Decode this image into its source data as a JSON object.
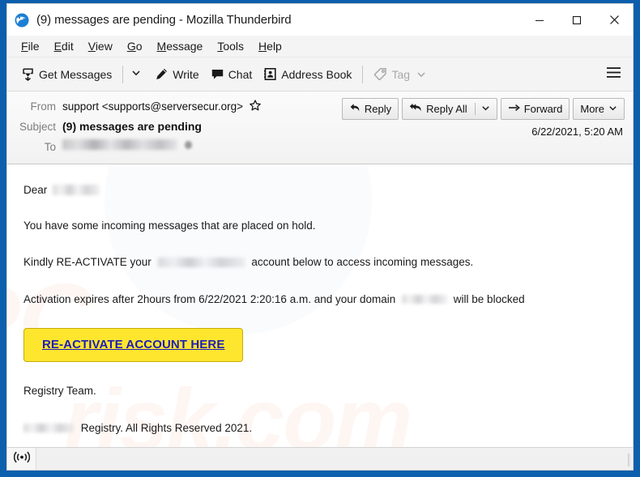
{
  "window": {
    "title": "(9) messages are pending - Mozilla Thunderbird",
    "logo_icon": "thunderbird-logo-icon",
    "controls": {
      "minimize": "minimize-icon",
      "maximize": "maximize-icon",
      "close": "close-icon"
    },
    "frame_color": "#0c5fad"
  },
  "menubar": {
    "items": [
      {
        "label": "File",
        "accel": "F"
      },
      {
        "label": "Edit",
        "accel": "E"
      },
      {
        "label": "View",
        "accel": "V"
      },
      {
        "label": "Go",
        "accel": "G"
      },
      {
        "label": "Message",
        "accel": "M"
      },
      {
        "label": "Tools",
        "accel": "T"
      },
      {
        "label": "Help",
        "accel": "H"
      }
    ]
  },
  "toolbar": {
    "get_messages_label": "Get Messages",
    "get_messages_icon": "download-tray-icon",
    "get_messages_caret_icon": "chevron-down-icon",
    "write_label": "Write",
    "write_icon": "pencil-icon",
    "chat_label": "Chat",
    "chat_icon": "speech-bubble-icon",
    "address_book_label": "Address Book",
    "address_book_icon": "address-book-icon",
    "tag_label": "Tag",
    "tag_icon": "tag-icon",
    "tag_caret_icon": "chevron-down-icon",
    "tag_disabled": true,
    "app_menu_icon": "hamburger-menu-icon"
  },
  "message_header": {
    "from_label": "From",
    "from_value": "support <supports@serversecur.org>",
    "star_icon": "star-outline-icon",
    "subject_label": "Subject",
    "subject_value": "(9) messages are pending",
    "to_label": "To",
    "to_value_redacted": true,
    "date": "6/22/2021, 5:20 AM",
    "actions": {
      "reply_label": "Reply",
      "reply_icon": "reply-arrow-icon",
      "reply_all_label": "Reply All",
      "reply_all_icon": "reply-all-arrow-icon",
      "reply_all_caret_icon": "chevron-down-icon",
      "forward_label": "Forward",
      "forward_icon": "forward-arrow-icon",
      "more_label": "More",
      "more_caret_icon": "chevron-down-icon"
    }
  },
  "message_body": {
    "greeting_prefix": "Dear",
    "greeting_name_redacted": true,
    "line_hold": "You have some incoming messages that are placed on hold.",
    "line_reactivate_prefix": "Kindly RE-ACTIVATE your",
    "line_reactivate_suffix": "account below to access incoming messages.",
    "line_expires_prefix": "Activation expires after 2hours from 6/22/2021 2:20:16 a.m.  and your domain",
    "line_expires_suffix": "will be blocked",
    "cta_label": "RE-ACTIVATE ACCOUNT HERE",
    "cta_bg_color": "#ffe62e",
    "cta_text_color": "#1d1dbb",
    "signoff": "Registry Team.",
    "copyright_suffix": "Registry. All Rights Reserved 2021."
  },
  "watermark": {
    "line1": "PC",
    "line2": "risk.com"
  },
  "statusbar": {
    "icon": "broadcast-signal-icon",
    "text": ""
  }
}
